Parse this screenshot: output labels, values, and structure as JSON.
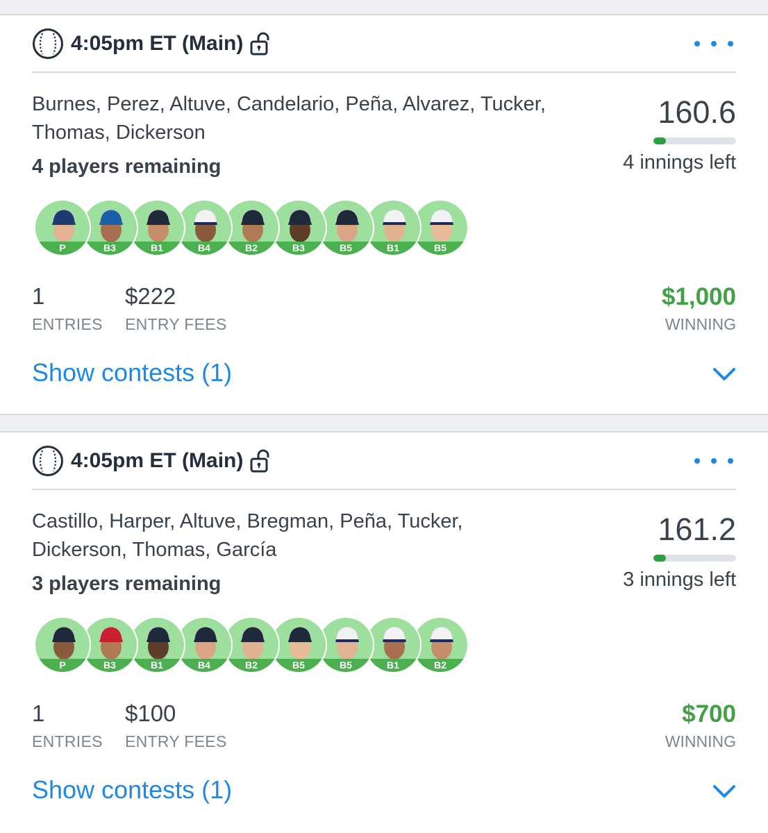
{
  "cards": [
    {
      "slate": "4:05pm ET (Main)",
      "players": "Burnes, Perez, Altuve, Candelario, Peña, Alvarez, Tucker, Thomas, Dickerson",
      "remaining": "4 players remaining",
      "score": "160.6",
      "progress_fraction": 0.15,
      "innings_left": "4 innings left",
      "roster": [
        {
          "pos": "P",
          "cap": "#1d3b6e"
        },
        {
          "pos": "B3",
          "cap": "#1b5fa8"
        },
        {
          "pos": "B1",
          "cap": "#1e2a3a"
        },
        {
          "pos": "B4",
          "cap": "#f2f2f4"
        },
        {
          "pos": "B2",
          "cap": "#1e2a3a"
        },
        {
          "pos": "B3",
          "cap": "#1e2a3a"
        },
        {
          "pos": "B5",
          "cap": "#1e2a3a"
        },
        {
          "pos": "B1",
          "cap": "#f2f2f4"
        },
        {
          "pos": "B5",
          "cap": "#f2f2f4"
        }
      ],
      "entries": "1",
      "entries_label": "ENTRIES",
      "fees": "$222",
      "fees_label": "ENTRY FEES",
      "winning": "$1,000",
      "winning_label": "WINNING",
      "show_contests": "Show contests (1)"
    },
    {
      "slate": "4:05pm ET (Main)",
      "players": "Castillo, Harper, Altuve, Bregman, Peña, Tucker, Dickerson, Thomas, García",
      "remaining": "3 players remaining",
      "score": "161.2",
      "progress_fraction": 0.15,
      "innings_left": "3 innings left",
      "roster": [
        {
          "pos": "P",
          "cap": "#1e2a3a"
        },
        {
          "pos": "B3",
          "cap": "#c8202f"
        },
        {
          "pos": "B1",
          "cap": "#1e2a3a"
        },
        {
          "pos": "B4",
          "cap": "#1e2a3a"
        },
        {
          "pos": "B2",
          "cap": "#1e2a3a"
        },
        {
          "pos": "B5",
          "cap": "#1e2a3a"
        },
        {
          "pos": "B5",
          "cap": "#f2f2f4"
        },
        {
          "pos": "B1",
          "cap": "#f2f2f4"
        },
        {
          "pos": "B2",
          "cap": "#f2f2f4"
        }
      ],
      "entries": "1",
      "entries_label": "ENTRIES",
      "fees": "$100",
      "fees_label": "ENTRY FEES",
      "winning": "$700",
      "winning_label": "WINNING",
      "show_contests": "Show contests (1)"
    }
  ],
  "icons": {
    "sport": "baseball-icon",
    "lock": "unlocked-padlock-icon",
    "more": "ellipsis-icon",
    "expand": "chevron-down-icon"
  },
  "colors": {
    "accent_blue": "#1e88e5",
    "winning_green": "#43a047",
    "progress_green": "#2e9e40",
    "avatar_bg": "#9ddf9d",
    "position_band": "#4caf50"
  }
}
